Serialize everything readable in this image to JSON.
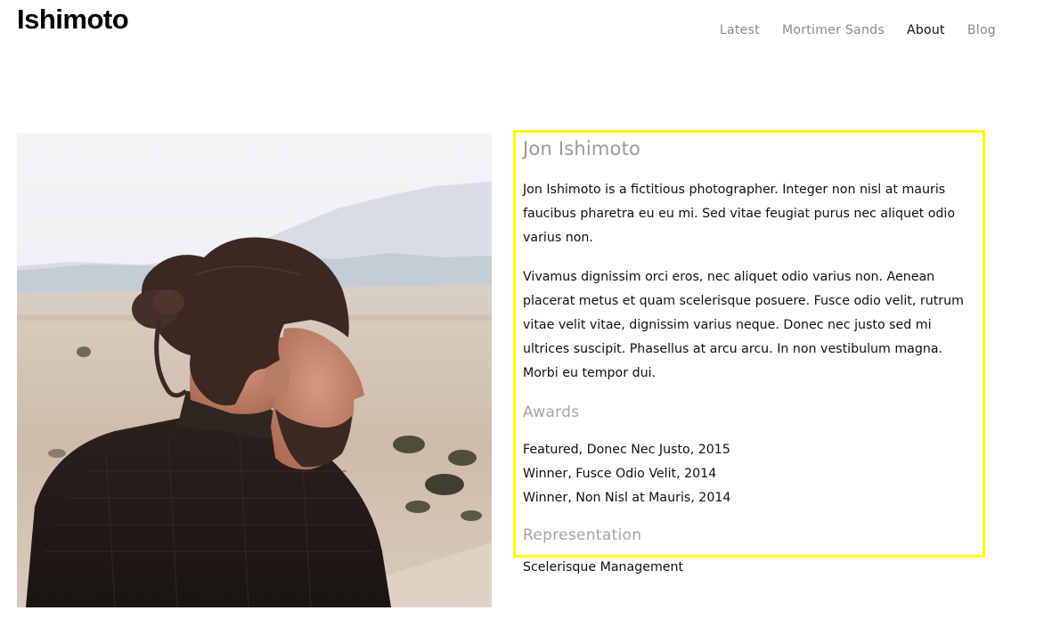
{
  "site": {
    "title": "Ishimoto"
  },
  "nav": {
    "items": [
      "Latest",
      "Mortimer Sands",
      "About",
      "Blog"
    ],
    "active": "About"
  },
  "bio": {
    "name": "Jon Ishimoto",
    "paragraphs": [
      "Jon Ishimoto is a fictitious photographer. Integer non nisl at mauris faucibus pharetra eu eu mi. Sed vitae feugiat purus nec aliquet odio varius non.",
      "Vivamus dignissim orci eros, nec aliquet odio varius non. Aenean placerat metus et quam scelerisque posuere. Fusce odio velit, rutrum vitae velit vitae, dignissim varius neque. Donec nec justo sed mi ultrices suscipit. Phasellus at arcu arcu. In non vestibulum magna. Morbi eu tempor dui."
    ],
    "awards_heading": "Awards",
    "awards": [
      "Featured, Donec Nec Justo, 2015",
      "Winner, Fusce Odio Velit, 2014",
      "Winner, Non Nisl at Mauris, 2014"
    ],
    "representation_heading": "Representation",
    "representation": "Scelerisque Management"
  },
  "colors": {
    "highlight_border": "#ffff00",
    "nav_inactive": "#8a8a8a",
    "heading_gray": "#9a9a9a"
  }
}
